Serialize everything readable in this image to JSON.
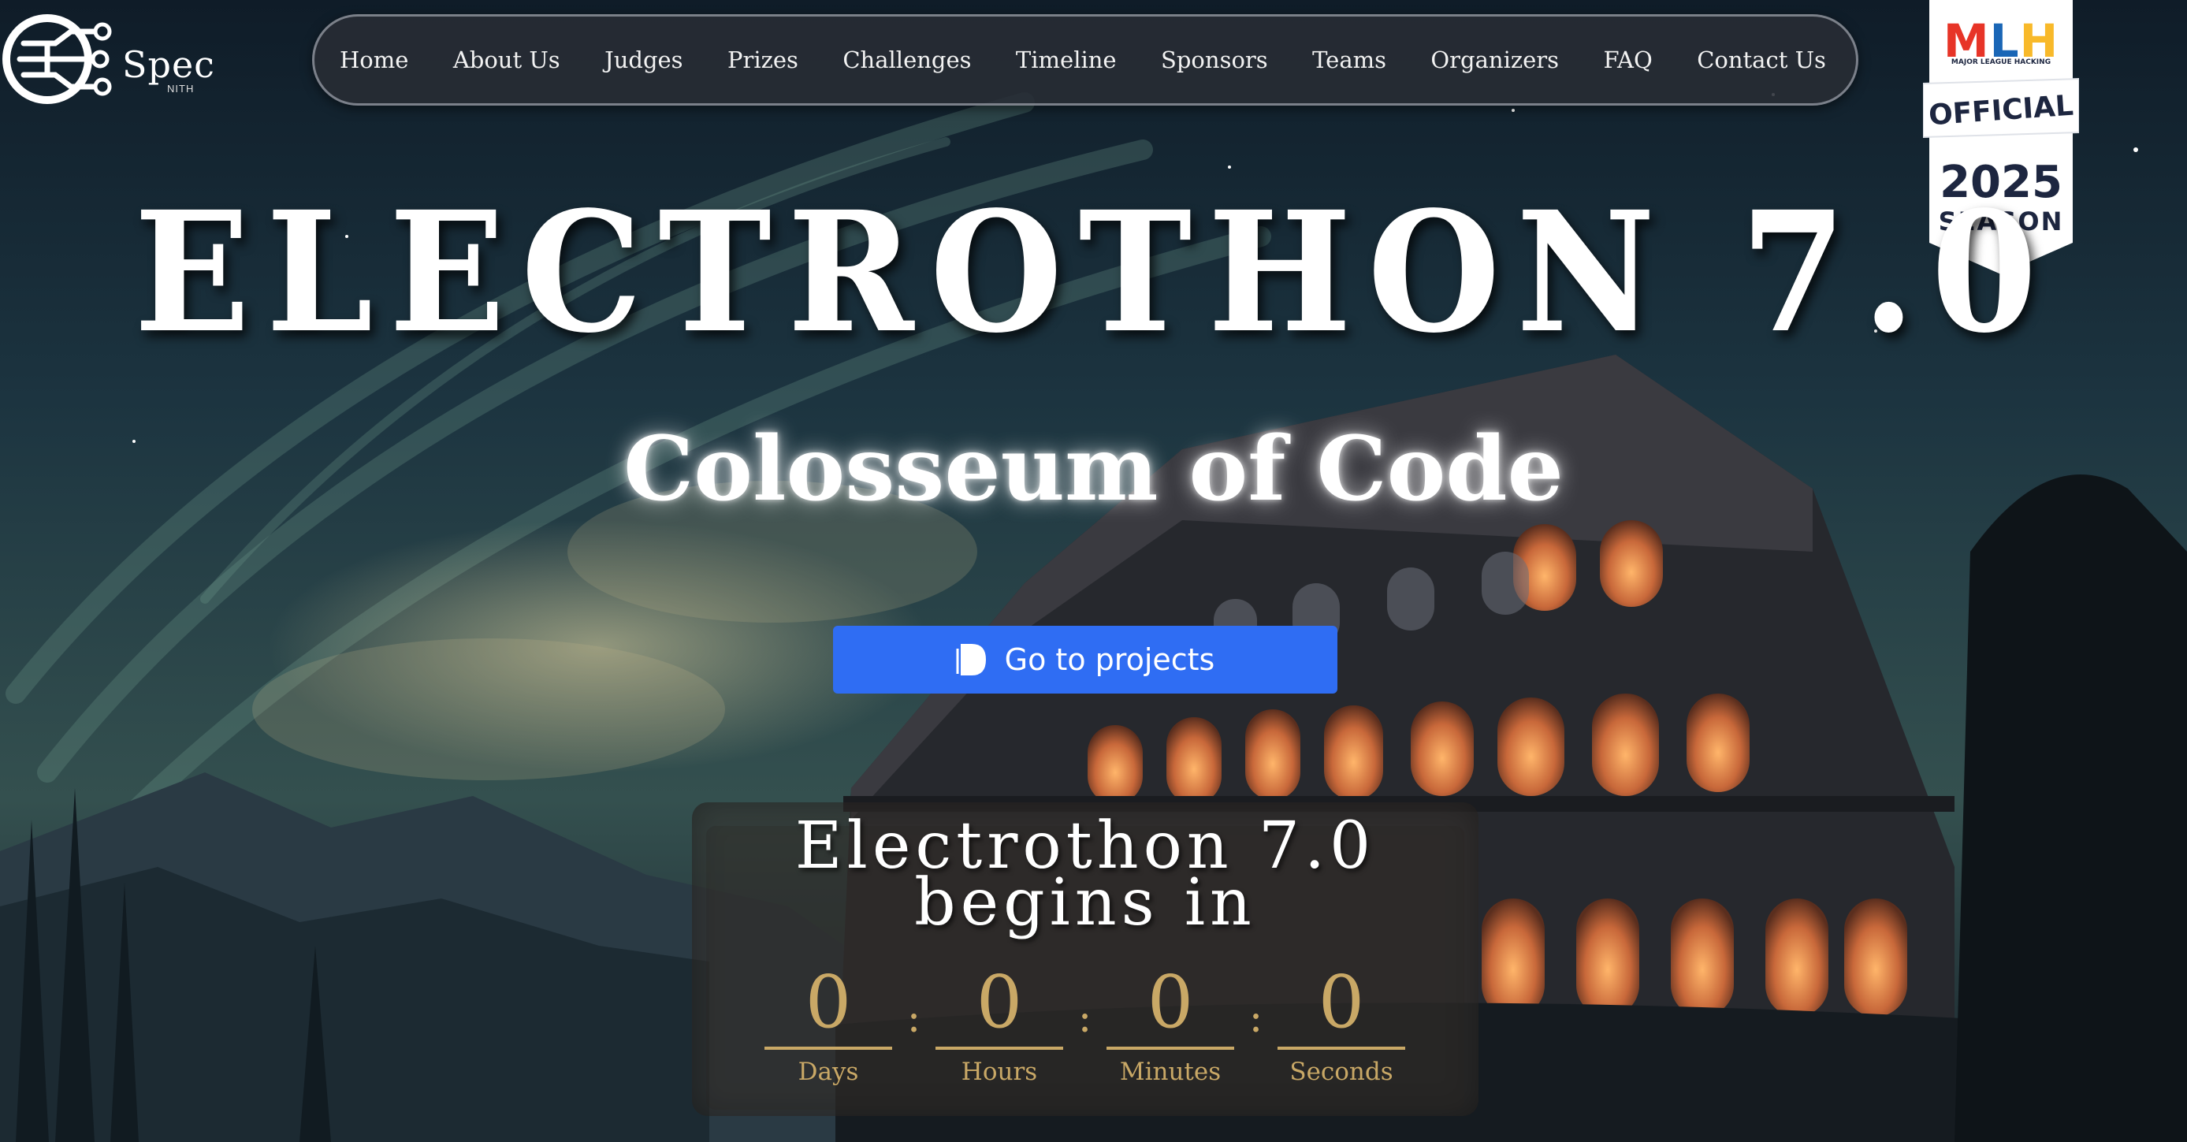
{
  "logo": {
    "text": "Spec",
    "sub": "NITH"
  },
  "nav": {
    "items": [
      {
        "label": "Home",
        "name": "nav-home"
      },
      {
        "label": "About Us",
        "name": "nav-about-us"
      },
      {
        "label": "Judges",
        "name": "nav-judges"
      },
      {
        "label": "Prizes",
        "name": "nav-prizes"
      },
      {
        "label": "Challenges",
        "name": "nav-challenges"
      },
      {
        "label": "Timeline",
        "name": "nav-timeline"
      },
      {
        "label": "Sponsors",
        "name": "nav-sponsors"
      },
      {
        "label": "Teams",
        "name": "nav-teams"
      },
      {
        "label": "Organizers",
        "name": "nav-organizers"
      },
      {
        "label": "FAQ",
        "name": "nav-faq"
      },
      {
        "label": "Contact Us",
        "name": "nav-contact-us"
      }
    ]
  },
  "mlh": {
    "logo": "MLH",
    "small": "MAJOR LEAGUE HACKING",
    "official": "OFFICIAL",
    "year": "2025",
    "season": "SEASON",
    "colors": {
      "m": "#e73427",
      "l": "#1a66b6",
      "h": "#f8b92a"
    }
  },
  "hero": {
    "title": "ELECTROTHON 7.0",
    "subtitle": "Colosseum of Code",
    "cta": {
      "label": "Go to projects",
      "icon": "devpost-icon",
      "color": "#2f6df3"
    }
  },
  "countdown": {
    "title": "Electrothon 7.0 begins in",
    "units": [
      {
        "value": "0",
        "label": "Days"
      },
      {
        "value": "0",
        "label": "Hours"
      },
      {
        "value": "0",
        "label": "Minutes"
      },
      {
        "value": "0",
        "label": "Seconds"
      }
    ],
    "separator": ":",
    "accent": "#c9a866"
  }
}
